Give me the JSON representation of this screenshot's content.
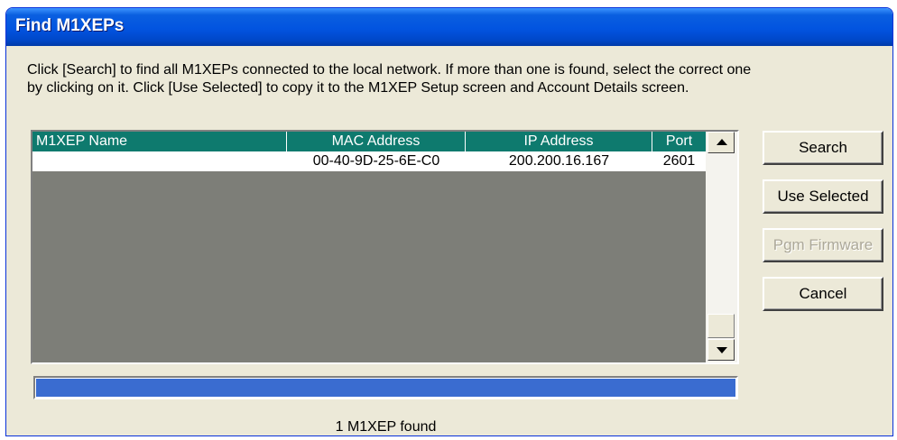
{
  "window": {
    "title": "Find M1XEPs"
  },
  "description": {
    "line1": "Click [Search] to find all M1XEPs connected to the local network.  If more than one is found, select the correct one",
    "line2": "by clicking on it.  Click [Use Selected] to copy it to the M1XEP Setup screen and Account Details screen."
  },
  "table": {
    "columns": [
      "M1XEP Name",
      "MAC Address",
      "IP Address",
      "Port"
    ],
    "rows": [
      {
        "name": "",
        "mac": "00-40-9D-25-6E-C0",
        "ip": "200.200.16.167",
        "port": "2601"
      }
    ]
  },
  "buttons": {
    "search": "Search",
    "use_selected": "Use Selected",
    "pgm_firmware": "Pgm Firmware",
    "cancel": "Cancel"
  },
  "progress": {
    "fraction": 1.0
  },
  "status": "1 M1XEP found",
  "colors": {
    "title_bar": "#0254E0",
    "header": "#0E7A6E",
    "list_background": "#7D7E78",
    "progress_fill": "#3A6CD0",
    "dialog": "#ECE9D8"
  }
}
